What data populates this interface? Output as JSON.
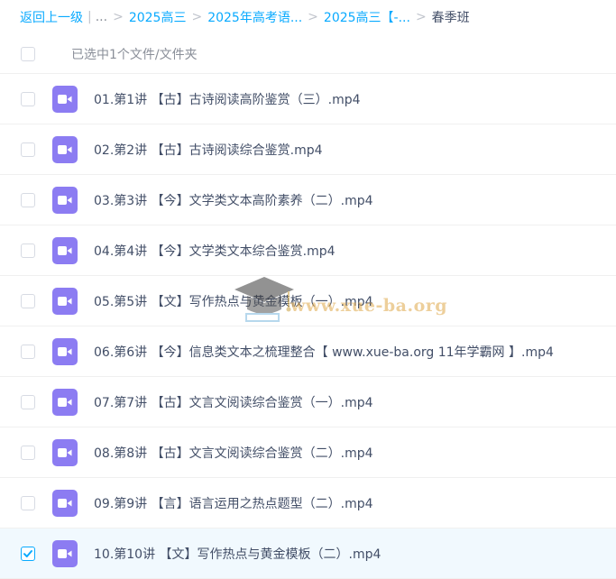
{
  "breadcrumb": {
    "back_label": "返回上一级",
    "ellipsis": "...",
    "items": [
      "2025高三",
      "2025年高考语...",
      "2025高三【-..."
    ],
    "current": "春季班"
  },
  "header": {
    "selected_text": "已选中1个文件/文件夹"
  },
  "files": [
    {
      "name": "01.第1讲 【古】古诗阅读高阶鉴赏（三）.mp4",
      "checked": false,
      "icon": "video-file-icon"
    },
    {
      "name": "02.第2讲 【古】古诗阅读综合鉴赏.mp4",
      "checked": false,
      "icon": "video-file-icon"
    },
    {
      "name": "03.第3讲 【今】文学类文本高阶素养（二）.mp4",
      "checked": false,
      "icon": "video-file-icon"
    },
    {
      "name": "04.第4讲 【今】文学类文本综合鉴赏.mp4",
      "checked": false,
      "icon": "video-file-icon"
    },
    {
      "name": "05.第5讲 【文】写作热点与黄金模板（一）.mp4",
      "checked": false,
      "icon": "video-file-icon"
    },
    {
      "name": "06.第6讲 【今】信息类文本之梳理整合【 www.xue-ba.org 11年学霸网 】.mp4",
      "checked": false,
      "icon": "video-file-icon"
    },
    {
      "name": "07.第7讲 【古】文言文阅读综合鉴赏（一）.mp4",
      "checked": false,
      "icon": "video-file-icon"
    },
    {
      "name": "08.第8讲 【古】文言文阅读综合鉴赏（二）.mp4",
      "checked": false,
      "icon": "video-file-icon"
    },
    {
      "name": "09.第9讲 【言】语言运用之热点题型（二）.mp4",
      "checked": false,
      "icon": "video-file-icon"
    },
    {
      "name": "10.第10讲 【文】写作热点与黄金模板（二）.mp4",
      "checked": true,
      "icon": "video-file-icon"
    }
  ],
  "watermark": {
    "text": "www.xue-ba.org"
  },
  "colors": {
    "link": "#09aaff",
    "text": "#424e67",
    "muted": "#8a8f99",
    "video_icon": "#8c7cf2",
    "selected_row": "#f1f9fe"
  }
}
